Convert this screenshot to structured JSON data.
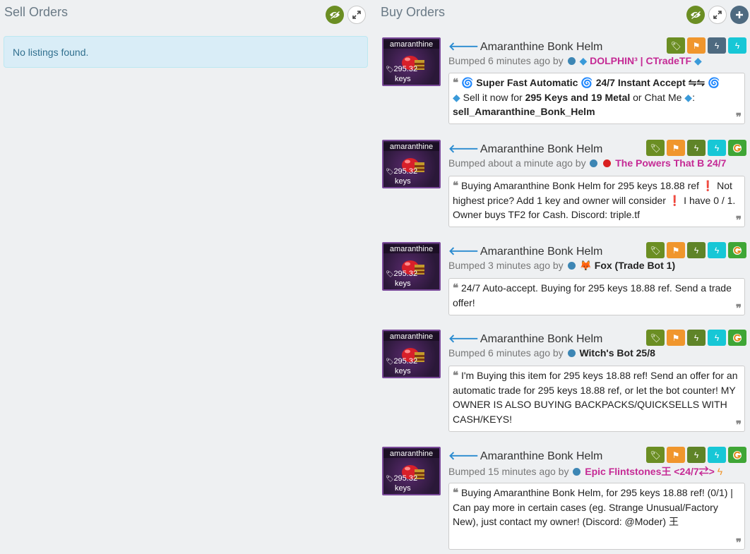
{
  "sell": {
    "title": "Sell Orders",
    "empty_message": "No listings found."
  },
  "buy": {
    "title": "Buy Orders"
  },
  "item": {
    "thumb_name": "amaranthine",
    "thumb_price": "295.32",
    "thumb_unit": "keys"
  },
  "listings": [
    {
      "title": "Amaranthine Bonk Helm",
      "bumped": "Bumped 6 minutes ago by",
      "user": "DOLPHIN³ | CTradeTF",
      "message_lines": [
        [
          "Super Fast Automatic",
          "24/7 Instant Accept ⇋⇋"
        ],
        [
          "Sell it now for",
          "295 Keys and 19 Metal",
          "or Chat Me",
          ":"
        ],
        [
          "sell_Amaranthine_Bonk_Helm"
        ]
      ]
    },
    {
      "title": "Amaranthine Bonk Helm",
      "bumped": "Bumped about a minute ago by",
      "user": "The Powers That B 24/7",
      "message": "Buying Amaranthine Bonk Helm for 295 keys 18.88 ref ❗ Not highest price? Add 1 key and owner will consider ❗ I have 0 / 1. Owner buys TF2 for Cash. Discord: triple.tf"
    },
    {
      "title": "Amaranthine Bonk Helm",
      "bumped": "Bumped 3 minutes ago by",
      "user": "Fox (Trade Bot 1)",
      "message": "24/7 Auto-accept. Buying for 295 keys 18.88 ref. Send a trade offer!"
    },
    {
      "title": "Amaranthine Bonk Helm",
      "bumped": "Bumped 6 minutes ago by",
      "user": "Witch's Bot 25/8",
      "message": "I'm Buying this item for 295 keys 18.88 ref! Send an offer for an automatic trade for 295 keys 18.88 ref, or let the bot counter! MY OWNER IS ALSO BUYING BACKPACKS/QUICKSELLS WITH CASH/KEYS!"
    },
    {
      "title": "Amaranthine Bonk Helm",
      "bumped": "Bumped 15 minutes ago by",
      "user": "Epic Flintstones王 <24/7⇄>",
      "message": "Buying Amaranthine Bonk Helm, for 295 keys 18.88 ref! (0/1) | Can pay more in certain cases (eg. Strange Unusual/Factory New), just contact my owner! (Discord: @Moder) 王"
    }
  ],
  "icons": {
    "visibility": "eye-icon",
    "expand": "expand-icon",
    "add": "plus-icon",
    "tag": "tag-icon",
    "flag": "flag-icon",
    "bolt": "lightning-icon",
    "gpr": "gpr-icon"
  },
  "colors": {
    "accent_green": "#6b8e23",
    "flag_orange": "#f0962d",
    "bolt_slate": "#4e6a80",
    "cyan": "#17c7d6",
    "username_pink": "#c52a95",
    "alert_bg": "#d9edf7"
  }
}
